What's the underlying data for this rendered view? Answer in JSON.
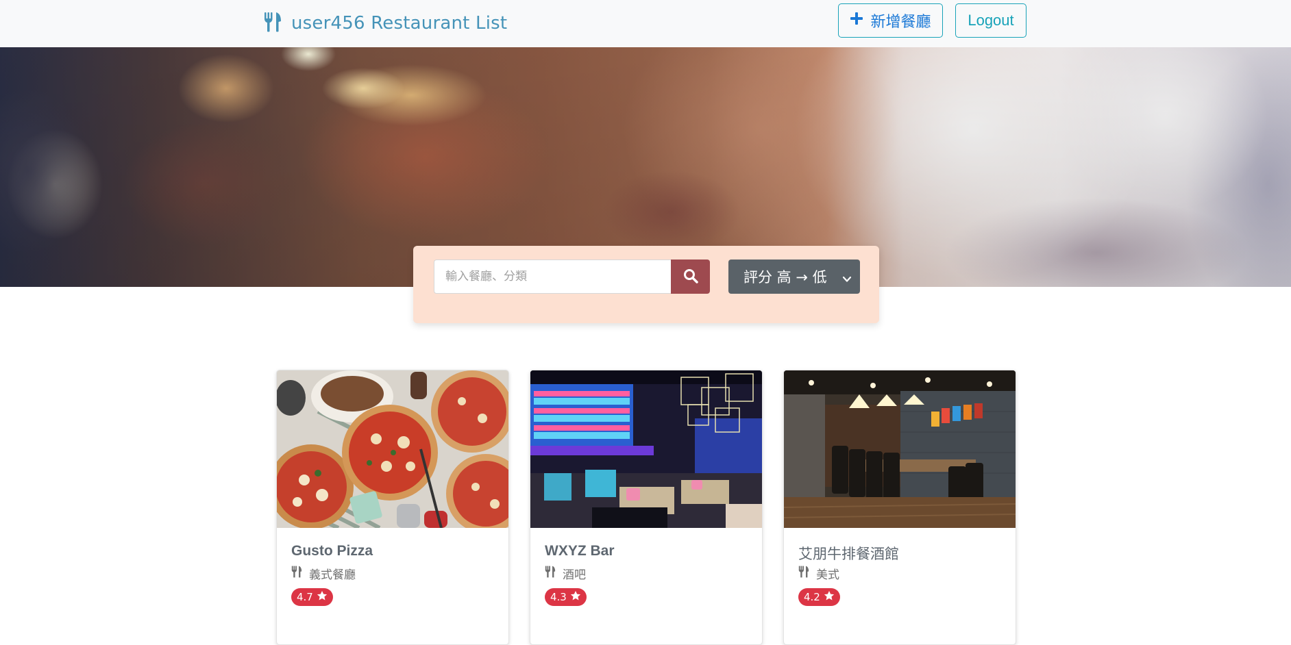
{
  "nav": {
    "brand_title": "user456 Restaurant List",
    "add_label": "新增餐廳",
    "logout_label": "Logout",
    "brand_color": "#4593b8",
    "button_border_color": "#17a2b8"
  },
  "search": {
    "placeholder": "輸入餐廳、分類",
    "value": "",
    "sort_selected": "評分 高 → 低",
    "panel_color": "#fde0d1",
    "button_color": "#9e4a4f"
  },
  "restaurants": [
    {
      "name": "Gusto Pizza",
      "category": "義式餐廳",
      "rating": "4.7",
      "image": "pizza-photo"
    },
    {
      "name": "WXYZ Bar",
      "category": "酒吧",
      "rating": "4.3",
      "image": "bar-interior-photo"
    },
    {
      "name": "艾朋牛排餐酒館",
      "category": "美式",
      "rating": "4.2",
      "image": "steakhouse-interior-photo"
    }
  ],
  "icons": {
    "brand": "utensils-icon",
    "add": "plus-icon",
    "search": "search-icon",
    "sort": "chevron-down-icon",
    "category": "utensils-icon",
    "rating": "star-icon"
  },
  "rating_badge_color": "#dc3545"
}
